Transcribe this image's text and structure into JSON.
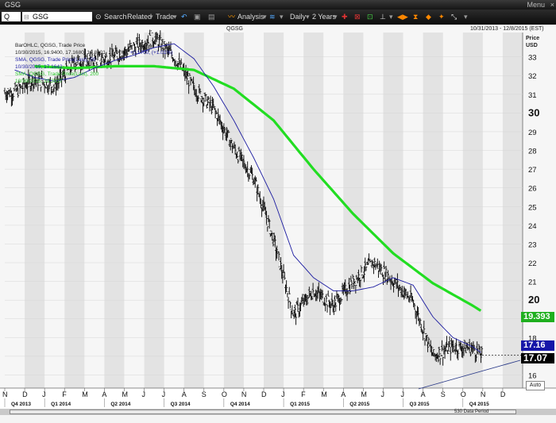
{
  "window": {
    "title": "GSG",
    "menu": "Menu",
    "close": "×"
  },
  "toolbar": {
    "symbol_prefix": "Q",
    "symbol": "GSG",
    "search": "Search",
    "related": "Related",
    "trade": "Trade",
    "analysis": "Analysis",
    "interval": "Daily",
    "range": "2 Years"
  },
  "chart": {
    "title": "QGSG",
    "date_range": "10/31/2013 - 12/8/2015 (EST)",
    "price_label_1": "Price",
    "price_label_2": "USD",
    "legend": {
      "l1": "BarOHLC, QGSG, Trade Price",
      "l2a": "10/30/2015, 16.9400, 17.1680, 16.8801, 17.0700,",
      "l2b": "+0.1700, (+1.01%)",
      "l3": "SMA, QGSG, Trade Price(Last), 50",
      "l4": "10/30/2015, 17.1642",
      "l5": "SMA, QGSG, Trade Price(Last), 200",
      "l6": "10/30/2015, 19.3937"
    },
    "tag_200": "19.393",
    "tag_50": "17.16",
    "tag_last": "17.07",
    "auto": "Auto",
    "period": "530 Data Period",
    "colors": {
      "sma50": "#1a1aa0",
      "sma200": "#22dd22",
      "bars": "#000000",
      "last": "#000000"
    }
  },
  "chart_data": {
    "type": "line",
    "title": "QGSG",
    "ylim": [
      15.3,
      34.3
    ],
    "y_ticks": [
      "16",
      "17",
      "18",
      "19",
      "20",
      "21",
      "22",
      "23",
      "24",
      "25",
      "26",
      "27",
      "28",
      "29",
      "30",
      "31",
      "32",
      "33"
    ],
    "x_month_labels": [
      "N",
      "D",
      "J",
      "F",
      "M",
      "A",
      "M",
      "J",
      "J",
      "A",
      "S",
      "O",
      "N",
      "D",
      "J",
      "F",
      "M",
      "A",
      "M",
      "J",
      "J",
      "A",
      "S",
      "O",
      "N",
      "D"
    ],
    "x_quarter_labels": [
      "Q4 2013",
      "Q1 2014",
      "Q2 2014",
      "Q3 2014",
      "Q4 2014",
      "Q1 2015",
      "Q2 2015",
      "Q3 2015",
      "Q4 2015"
    ],
    "series": [
      {
        "name": "BarOHLC, QGSG, Trade Price",
        "x": [
          "Nov 2013",
          "Dec 2013",
          "Jan 2014",
          "Feb 2014",
          "Mar 2014",
          "Apr 2014",
          "May 2014",
          "Jun 2014",
          "Jul 2014",
          "Aug 2014",
          "Sep 2014",
          "Oct 2014",
          "Nov 2014",
          "Dec 2014",
          "Jan 2015",
          "Feb 2015",
          "Mar 2015",
          "Apr 2015",
          "May 2015",
          "Jun 2015",
          "Jul 2015",
          "Aug 2015",
          "Sep 2015",
          "Oct 2015",
          "Oct 30 2015"
        ],
        "values": [
          31.1,
          31.8,
          31.4,
          32.7,
          32.8,
          33.0,
          33.5,
          34.0,
          33.0,
          31.3,
          30.2,
          28.1,
          26.5,
          23.2,
          19.2,
          20.5,
          19.7,
          21.0,
          22.0,
          21.0,
          19.9,
          17.0,
          17.5,
          17.4,
          17.07
        ]
      },
      {
        "name": "SMA, QGSG, Trade Price(Last), 50",
        "x": [
          "Nov 2013",
          "Dec 2013",
          "Jan 2014",
          "Feb 2014",
          "Mar 2014",
          "Apr 2014",
          "May 2014",
          "Jun 2014",
          "Jul 2014",
          "Aug 2014",
          "Sep 2014",
          "Oct 2014",
          "Nov 2014",
          "Dec 2014",
          "Jan 2015",
          "Feb 2015",
          "Mar 2015",
          "Apr 2015",
          "May 2015",
          "Jun 2015",
          "Jul 2015",
          "Aug 2015",
          "Sep 2015",
          "Oct 2015",
          "Oct 30 2015"
        ],
        "values": [
          32.3,
          31.9,
          31.7,
          31.9,
          32.4,
          32.8,
          33.1,
          33.5,
          33.7,
          32.9,
          31.4,
          29.6,
          27.6,
          25.4,
          22.4,
          21.2,
          20.5,
          20.5,
          20.7,
          21.2,
          20.8,
          19.1,
          18.0,
          17.5,
          17.16
        ]
      },
      {
        "name": "SMA, QGSG, Trade Price(Last), 200",
        "x": [
          "Dec 2013",
          "Feb 2014",
          "Apr 2014",
          "Jun 2014",
          "Aug 2014",
          "Oct 2014",
          "Dec 2014",
          "Feb 2015",
          "Apr 2015",
          "Jun 2015",
          "Aug 2015",
          "Oct 2015",
          "Oct 30 2015"
        ],
        "values": [
          32.5,
          32.4,
          32.5,
          32.5,
          32.3,
          31.3,
          29.6,
          27.0,
          24.6,
          22.5,
          20.9,
          19.7,
          19.39
        ]
      }
    ]
  }
}
